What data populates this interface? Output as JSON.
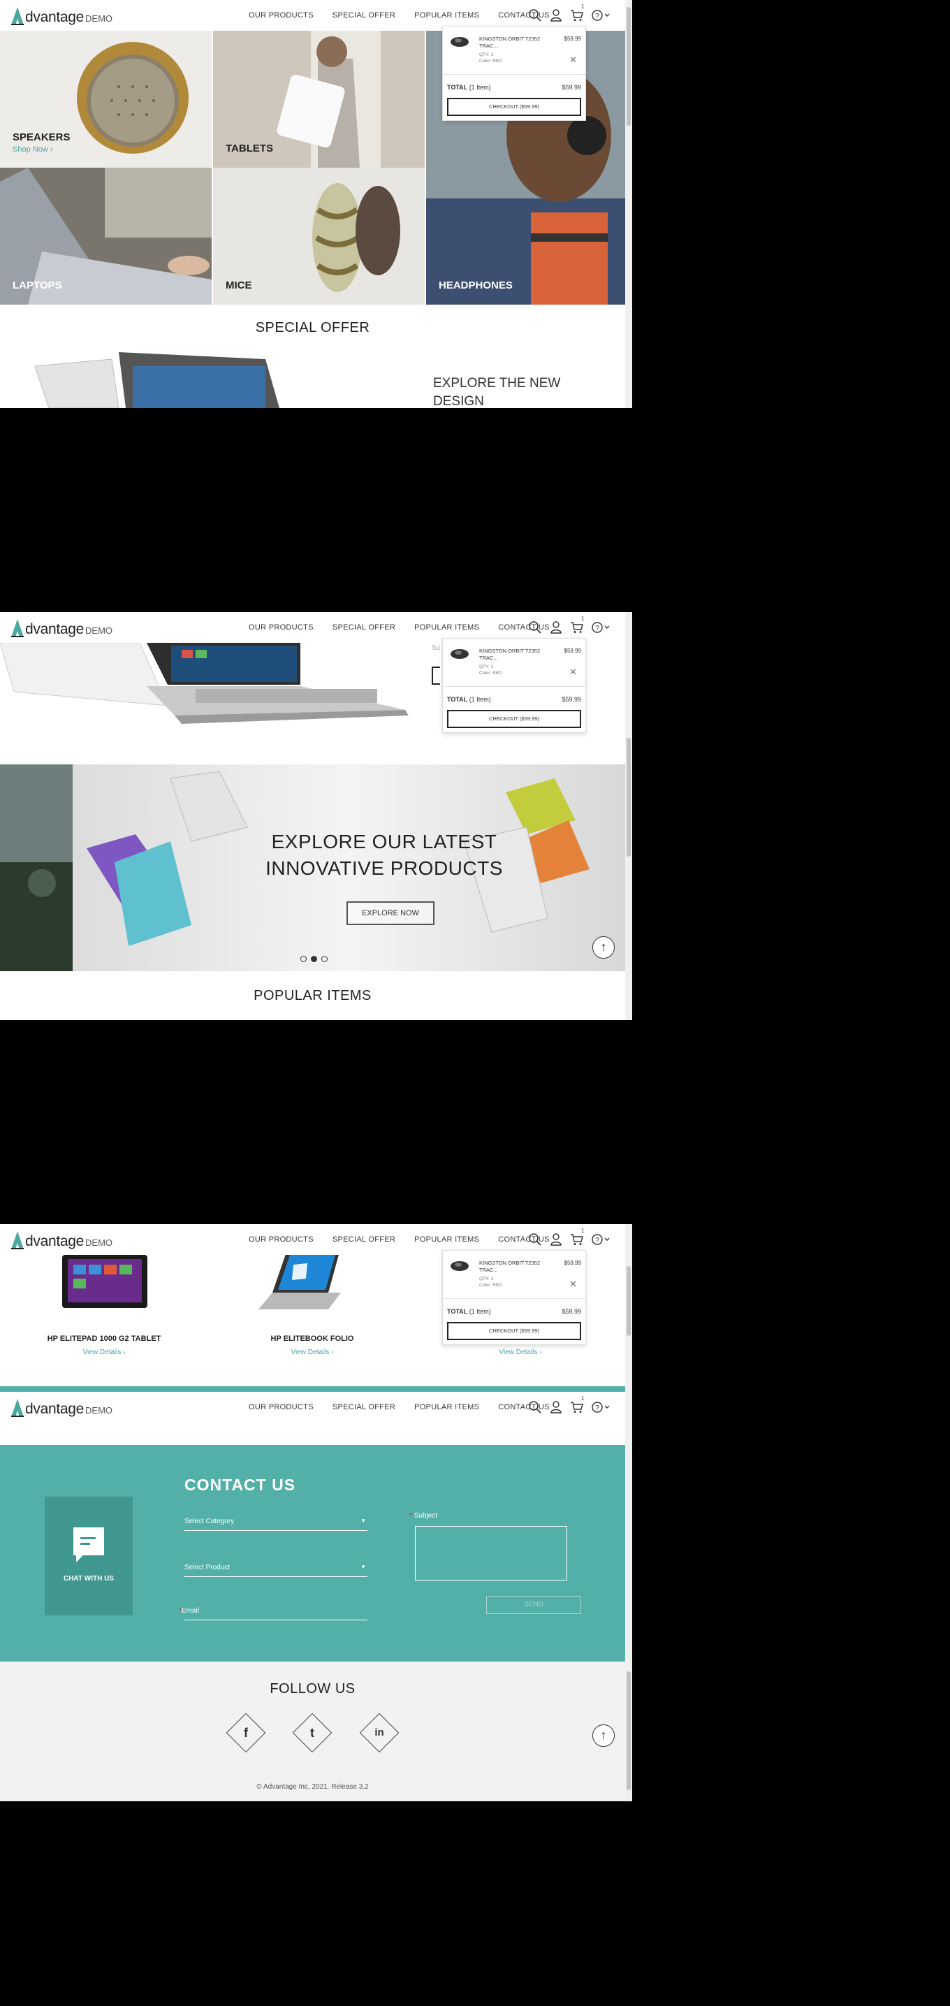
{
  "header": {
    "logo_word": "dvantage",
    "logo_demo": "DEMO",
    "nav": [
      "OUR PRODUCTS",
      "SPECIAL OFFER",
      "POPULAR ITEMS",
      "CONTACT US"
    ],
    "cart_count": "1"
  },
  "cart": {
    "item_name": "KINGSTON ORBIT T2352 TRAC...",
    "item_price": "$59.99",
    "qty": "QTY: 1",
    "color": "Color: RED",
    "total_label": "TOTAL",
    "total_items": "(1 Item)",
    "total_price": "$59.99",
    "checkout": "CHECKOUT ($59.99)"
  },
  "categories": {
    "speakers": "SPEAKERS",
    "shop_now": "Shop Now ›",
    "tablets": "TABLETS",
    "laptops": "LAPTOPS",
    "mice": "MICE",
    "headphones": "HEADPHONES"
  },
  "special_offer": {
    "heading": "SPECIAL OFFER",
    "explore_text": "EXPLORE THE NEW DESIGN",
    "sub_stub": "Su"
  },
  "hero": {
    "title_line1": "EXPLORE OUR LATEST",
    "title_line2": "INNOVATIVE PRODUCTS",
    "button": "EXPLORE NOW",
    "active_dot": 2
  },
  "popular": {
    "heading": "POPULAR ITEMS",
    "items": [
      {
        "name": "HP ELITEPAD 1000 G2 TABLET",
        "link": "View Details ›"
      },
      {
        "name": "HP ELITEBOOK FOLIO",
        "link": "View Details ›"
      },
      {
        "name": "",
        "link": "View Details ›"
      }
    ]
  },
  "contact": {
    "heading": "CONTACT US",
    "chat": "CHAT WITH US",
    "category": "Select Category",
    "product": "Select Product",
    "email": "Email",
    "subject": "Subject",
    "send": "SEND"
  },
  "follow": {
    "heading": "FOLLOW US",
    "networks": [
      "f",
      "t",
      "in"
    ]
  },
  "footer": {
    "copyright": "© Advantage Inc, 2021. Release 3.2"
  },
  "colors": {
    "accent": "#53b0a8",
    "link": "#4aa8a0"
  }
}
